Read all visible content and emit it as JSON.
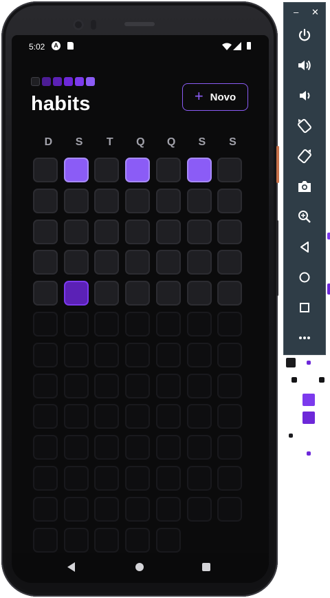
{
  "status_bar": {
    "time": "5:02",
    "a_icon": "A"
  },
  "header": {
    "title": "habits",
    "new_button_label": "Novo",
    "logo_colors": [
      "#1f1f23",
      "#4c1d95",
      "#5b21b6",
      "#6d28d9",
      "#7c3aed",
      "#8b5cf6"
    ]
  },
  "weekdays": [
    "D",
    "S",
    "T",
    "Q",
    "Q",
    "S",
    "S"
  ],
  "habit_grid": {
    "columns": 7,
    "total_cells": 89,
    "past_cells": 35,
    "completion_levels": {
      "1": 3,
      "3": 3,
      "5": 3,
      "29": 4
    },
    "colors": {
      "level3": "#8b5cf6",
      "level4": "#5b21b6",
      "empty": "#1f1f23",
      "future": "#0f0f11"
    }
  },
  "emulator_panel": {
    "buttons": [
      "power-icon",
      "volume-up-icon",
      "volume-down-icon",
      "rotate-left-icon",
      "rotate-right-icon",
      "camera-icon",
      "zoom-icon",
      "back-icon",
      "home-icon",
      "overview-icon",
      "more-icon"
    ]
  }
}
